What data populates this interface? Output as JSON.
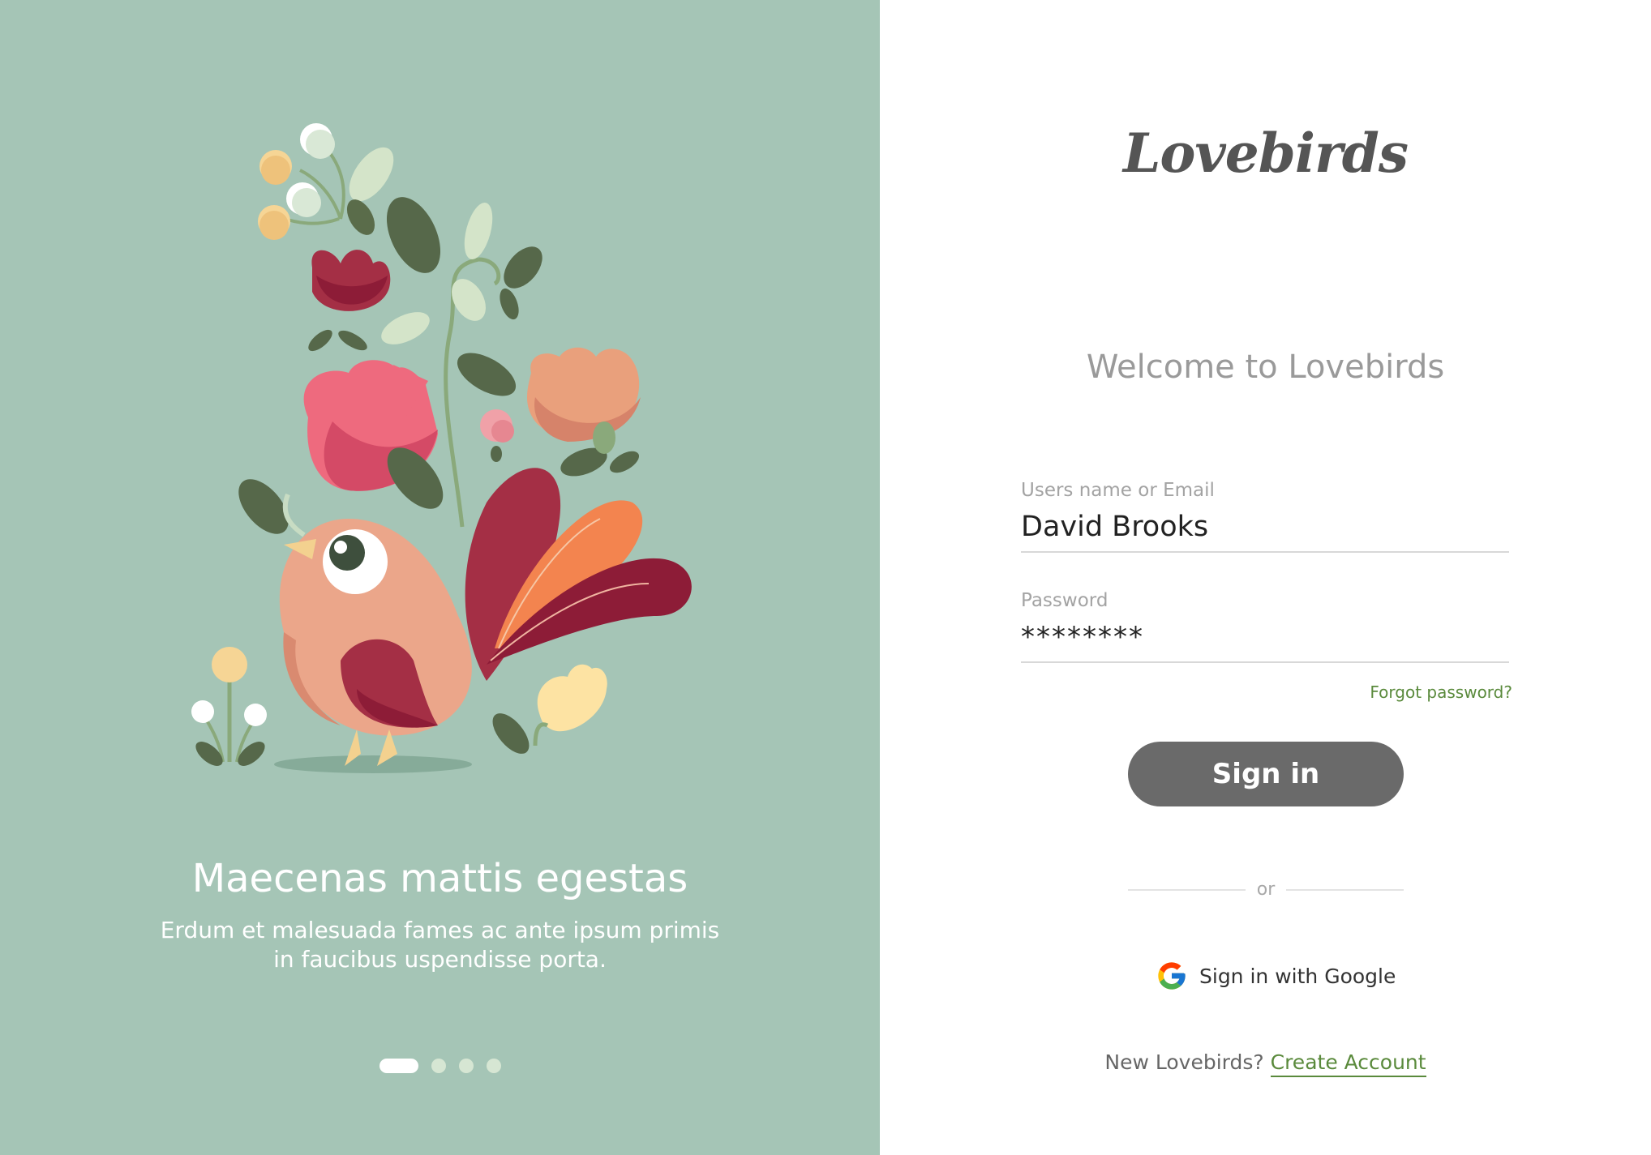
{
  "slide": {
    "title": "Maecenas mattis egestas",
    "subtitle": "Erdum et malesuada fames ac ante ipsum primis in faucibus uspendisse porta.",
    "dots_count": 4,
    "active_dot": 1
  },
  "brand": {
    "logo": "Lovebirds"
  },
  "form": {
    "welcome": "Welcome to Lovebirds",
    "username_label": "Users name or Email",
    "username_value": "David Brooks",
    "password_label": "Password",
    "password_value": "********",
    "forgot": "Forgot password?",
    "signin": "Sign in",
    "or": "or",
    "google": "Sign in with Google",
    "new_prompt": "New Lovebirds?",
    "create": "Create Account"
  },
  "colors": {
    "left_bg": "#a5c5b6",
    "accent_green": "#5a8a3c",
    "button": "#6a6a6a"
  },
  "icons": {
    "google": "google-g-icon",
    "illustration": "bird-with-flowers-illustration"
  }
}
